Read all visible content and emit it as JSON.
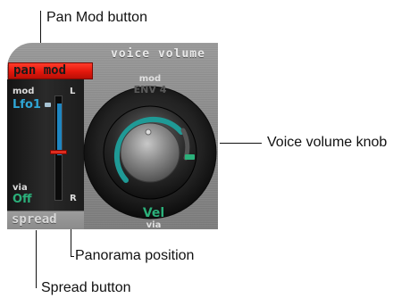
{
  "callouts": {
    "pan_mod_button": "Pan Mod button",
    "voice_volume_knob": "Voice volume knob",
    "panorama_position": "Panorama position",
    "spread_button": "Spread button"
  },
  "panel": {
    "voice_volume_label": "voice volume",
    "pan_mod_label": "pan mod",
    "spread_label": "spread",
    "mod_label_left": "mod",
    "mod_source_left": "Lfo1",
    "via_label_left": "via",
    "via_source_left": "Off",
    "left_marker": "L",
    "right_marker": "R",
    "knob_mod_label": "mod",
    "knob_mod_source": "ENV 4",
    "knob_via_source": "Vel",
    "knob_via_label": "via"
  },
  "colors": {
    "pan_mod_active": "#e3170c",
    "mod_source_blue": "#2fa6d6",
    "via_green": "#2bb07a",
    "knob_ring_teal": "#1f9a96",
    "pan_marker_red": "#e02b1e"
  },
  "controls": {
    "pan_position_fraction": 0.5
  }
}
